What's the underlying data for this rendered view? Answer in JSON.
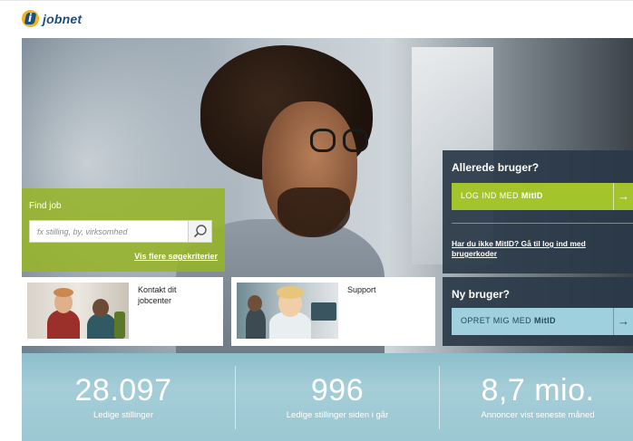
{
  "header": {
    "logo_text": "jobnet",
    "logo_glyph": "i"
  },
  "find_job": {
    "title": "Find job",
    "search_placeholder": "fx stilling, by, virksomhed",
    "more_criteria_link": "Vis flere søgekriterier"
  },
  "cards": [
    {
      "label": "Kontakt dit jobcenter"
    },
    {
      "label": "Support"
    }
  ],
  "login": {
    "existing_title": "Allerede bruger?",
    "login_button_prefix": "LOG IND MED",
    "mitid_mark": "MitID",
    "no_mitid_link": "Har du ikke MitID? Gå til log ind med brugerkoder",
    "new_title": "Ny bruger?",
    "create_button_prefix": "OPRET MIG MED",
    "arrow": "→"
  },
  "stats": [
    {
      "value": "28.097",
      "label": "Ledige stillinger"
    },
    {
      "value": "996",
      "label": "Ledige stillinger siden i går"
    },
    {
      "value": "8,7 mio.",
      "label": "Annoncer vist seneste måned"
    }
  ],
  "colors": {
    "brand_blue": "#1b4f82",
    "find_job_green": "#a3c52b",
    "login_panel": "#2a3848",
    "create_button": "#9fd0de",
    "stats_band": "#9bc8d3"
  }
}
